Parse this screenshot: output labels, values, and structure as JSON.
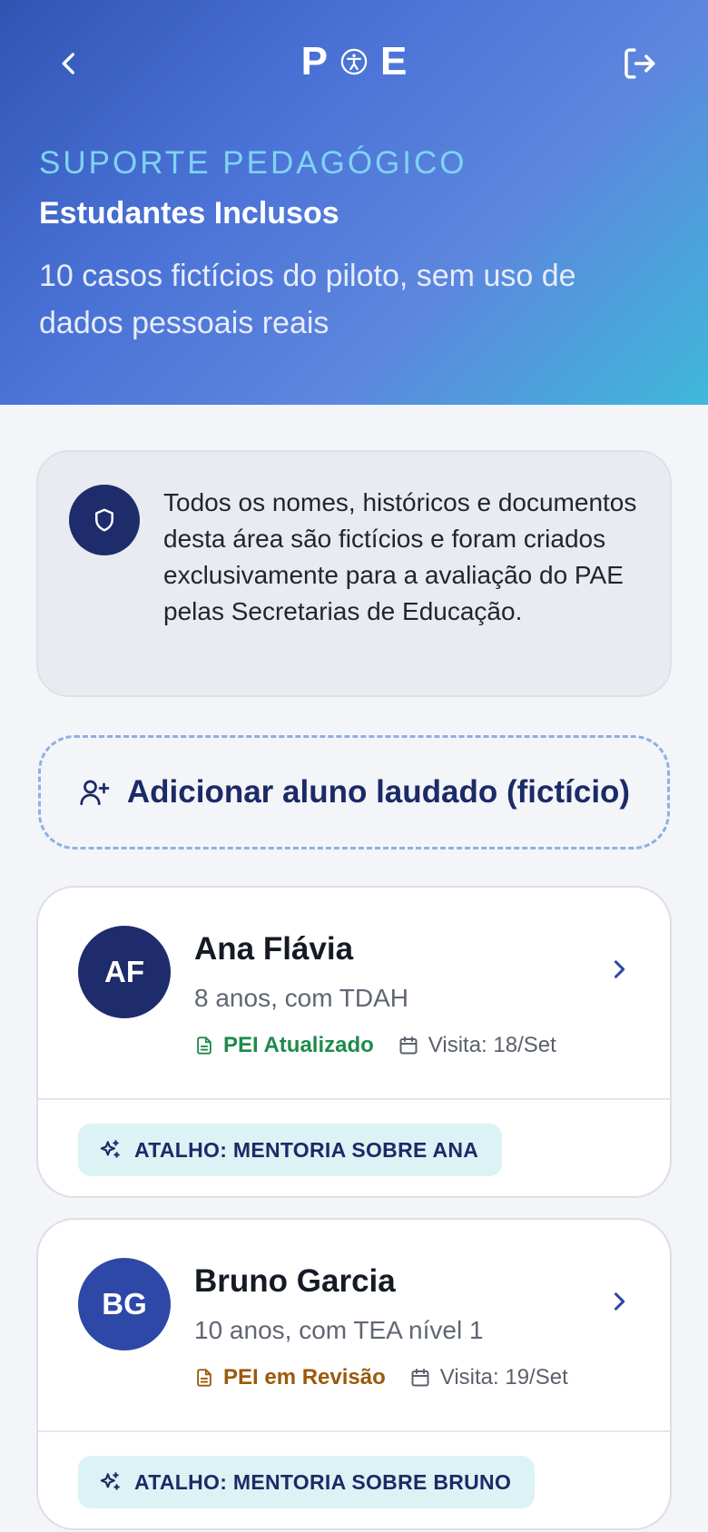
{
  "header": {
    "back_icon": "chevron-left-icon",
    "logout_icon": "logout-icon",
    "logo": {
      "left": "P",
      "mark_icon": "accessibility-icon",
      "right": "E"
    },
    "eyebrow": "SUPORTE PEDAGÓGICO",
    "title": "Estudantes Inclusos",
    "subtitle": "10 casos fictícios do piloto, sem uso de dados pessoais reais"
  },
  "notice": {
    "icon": "shield-icon",
    "text": "Todos os nomes, históricos e documentos desta área são fictícios e foram criados exclusivamente para a avaliação do PAE pelas Secretarias de Educação."
  },
  "add_student": {
    "icon": "user-plus-icon",
    "label": "Adicionar aluno laudado (fictício)"
  },
  "students": [
    {
      "initials": "AF",
      "name": "Ana Flávia",
      "description": "8 anos, com TDAH",
      "pei_status": "PEI Atualizado",
      "pei_color": "#1f8a4c",
      "visit": "Visita: 18/Set",
      "shortcut": "ATALHO: MENTORIA SOBRE ANA",
      "avatar_color": "#1e2c6b"
    },
    {
      "initials": "BG",
      "name": "Bruno Garcia",
      "description": "10 anos, com TEA nível 1",
      "pei_status": "PEI em Revisão",
      "pei_color": "#9a5a0a",
      "visit": "Visita: 19/Set",
      "shortcut": "ATALHO: MENTORIA SOBRE BRUNO",
      "avatar_color": "#2d48a6"
    }
  ],
  "colors": {
    "primary_dark": "#1e2c6b",
    "accent_cyan": "#7fd3f2",
    "shortcut_bg": "#dcf3f6"
  }
}
